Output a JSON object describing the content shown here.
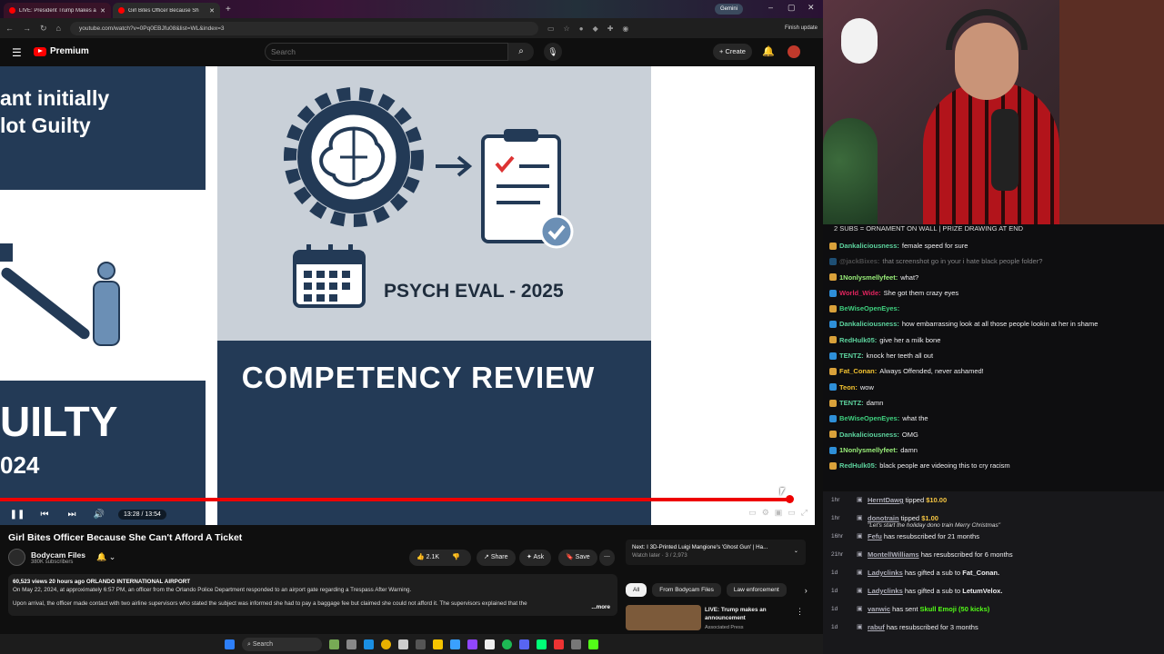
{
  "browser": {
    "tabs": [
      {
        "title": "LIVE: President Trump Makes an"
      },
      {
        "title": "Girl Bites Officer Because Sh"
      }
    ],
    "new_tab": "+",
    "gemini": "Gemini",
    "url": "youtube.com/watch?v=0Pq0EBJfu08&list=WL&index=3",
    "finish_update": "Finish update"
  },
  "youtube": {
    "logo_text": "Premium",
    "search_placeholder": "Search",
    "create_label": "Create",
    "player": {
      "left_slide_line1": "ant initially",
      "left_slide_line2": "lot Guilty",
      "left_slide_big": "UILTY",
      "left_slide_year": "024",
      "psych_eval": "PSYCH EVAL - 2025",
      "competency": "COMPETENCY REVIEW",
      "time": "13:28 / 13:54",
      "progress": 0.969
    },
    "video": {
      "title": "Girl Bites Officer Because She Can't Afford A Ticket",
      "channel": "Bodycam Files",
      "subscribers": "380K subscribers",
      "likes": "2.1K",
      "share": "Share",
      "ask": "Ask",
      "save": "Save",
      "meta": "60,523 views  20 hours ago  ORLANDO INTERNATIONAL AIRPORT",
      "desc1": "On May 22, 2024, at approximately 6:57 PM, an officer from the Orlando Police Department responded to an airport gate regarding a Trespass After Warning.",
      "desc2": "Upon arrival, the officer made contact with two airline supervisors who stated the subject was informed she had to pay a baggage fee but claimed she could not afford it. The supervisors explained that the",
      "more": "...more"
    },
    "sidebar": {
      "next_title": "Next: I 3D-Printed Luigi Mangione's 'Ghost Gun' | Ha...",
      "next_sub": "Watch later · 3 / 2,973",
      "chips": [
        "All",
        "From Bodycam Files",
        "Law enforcement"
      ],
      "rec_title": "LIVE: Trump makes an announcement",
      "rec_channel": "Associated Press"
    }
  },
  "taskbar": {
    "search": "Search"
  },
  "stream": {
    "banner": "2 SUBS = ORNAMENT ON WALL | PRIZE DRAWING AT END",
    "chat": [
      {
        "user": "Dankaliciousness:",
        "text": "female speed for sure",
        "color": "#5dd39e"
      },
      {
        "user": "@jackBixes:",
        "text": "that screenshot go in your i hate black people folder?",
        "color": "#888888",
        "dim": true
      },
      {
        "user": "1Nonlysmellyfeet:",
        "text": "what?",
        "color": "#9af07a"
      },
      {
        "user": "World_Wide:",
        "text": "She got them crazy eyes",
        "color": "#e0245e"
      },
      {
        "user": "BeWiseOpenEyes:",
        "text": "",
        "color": "#3fd07f"
      },
      {
        "user": "Dankaliciousness:",
        "text": "how embarrassing look at all those people lookin at her in shame",
        "color": "#5dd39e"
      },
      {
        "user": "RedHulk05:",
        "text": "give her a milk bone",
        "color": "#5dd39e"
      },
      {
        "user": "TENTZ:",
        "text": "knock her teeth all out",
        "color": "#5dd39e"
      },
      {
        "user": "Fat_Conan:",
        "text": "Always Offended, never ashamed!",
        "color": "#f2c230"
      },
      {
        "user": "Teon:",
        "text": "wow",
        "color": "#f2c230"
      },
      {
        "user": "TENTZ:",
        "text": "damn",
        "color": "#5dd39e"
      },
      {
        "user": "BeWiseOpenEyes:",
        "text": "what the",
        "color": "#3fd07f"
      },
      {
        "user": "Dankaliciousness:",
        "text": "OMG",
        "color": "#5dd39e"
      },
      {
        "user": "1Nonlysmellyfeet:",
        "text": "damn",
        "color": "#9af07a"
      },
      {
        "user": "RedHulk05:",
        "text": "black people are videoing this to cry racism",
        "color": "#5dd39e"
      }
    ],
    "events": [
      {
        "time": "1hr",
        "user": "HerntDawg",
        "text": "tipped",
        "amount": "$10.00",
        "note": ""
      },
      {
        "time": "1hr",
        "user": "donotrain",
        "text": "tipped",
        "amount": "$1.00",
        "note": "Let's start the holiday dono train Merry Christmas"
      },
      {
        "time": "16hr",
        "user": "Fefu",
        "text": "has resubscribed for 21 months",
        "amount": "",
        "note": ""
      },
      {
        "time": "21hr",
        "user": "MontellWilliams",
        "text": "has resubscribed for 6 months",
        "amount": "",
        "note": ""
      },
      {
        "time": "1d",
        "user": "Ladyclinks",
        "text": "has gifted a sub to",
        "amount": "Fat_Conan.",
        "note": ""
      },
      {
        "time": "1d",
        "user": "Ladyclinks",
        "text": "has gifted a sub to",
        "amount": "LetumVelox.",
        "note": ""
      },
      {
        "time": "1d",
        "user": "vanwic",
        "text": "has sent",
        "amount": "Skull Emoji (50 kicks)",
        "note": ""
      },
      {
        "time": "1d",
        "user": "rabuf",
        "text": "has resubscribed for 3 months",
        "amount": "",
        "note": ""
      }
    ]
  }
}
